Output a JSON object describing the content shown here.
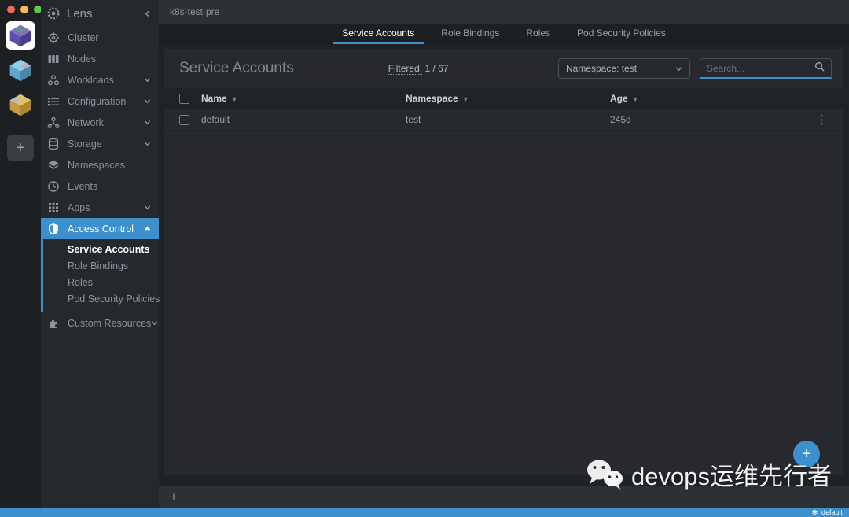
{
  "window": {
    "traffic_lights": [
      "close",
      "minimize",
      "maximize"
    ],
    "cluster_name": "k8s-test-pre"
  },
  "rail": {
    "clusters": [
      "purple-cluster",
      "blue-cluster",
      "yellow-cluster"
    ],
    "add_label": "+"
  },
  "sidebar": {
    "app_title": "Lens",
    "items": [
      {
        "label": "Cluster"
      },
      {
        "label": "Nodes"
      },
      {
        "label": "Workloads"
      },
      {
        "label": "Configuration"
      },
      {
        "label": "Network"
      },
      {
        "label": "Storage"
      },
      {
        "label": "Namespaces"
      },
      {
        "label": "Events"
      },
      {
        "label": "Apps"
      },
      {
        "label": "Access Control"
      },
      {
        "label": "Custom Resources"
      }
    ],
    "access_control_children": [
      {
        "label": "Service Accounts"
      },
      {
        "label": "Role Bindings"
      },
      {
        "label": "Roles"
      },
      {
        "label": "Pod Security Policies"
      }
    ]
  },
  "tabs": [
    {
      "label": "Service Accounts"
    },
    {
      "label": "Role Bindings"
    },
    {
      "label": "Roles"
    },
    {
      "label": "Pod Security Policies"
    }
  ],
  "content": {
    "title": "Service Accounts",
    "filtered_label": "Filtered:",
    "filtered_value": "1 / 67",
    "namespace_select_value": "Namespace: test",
    "search_placeholder": "Search...",
    "table": {
      "columns": [
        {
          "label": "Name"
        },
        {
          "label": "Namespace"
        },
        {
          "label": "Age"
        }
      ],
      "rows": [
        {
          "name": "default",
          "namespace": "test",
          "age": "245d"
        }
      ]
    }
  },
  "dock": {
    "add_label": "+"
  },
  "fab_label": "+",
  "statusbar": {
    "namespace": "default"
  },
  "watermark": {
    "text": "devops运维先行者"
  },
  "colors": {
    "accent_blue": "#3d90ce",
    "panel": "#27292e",
    "sidebar": "#25282d",
    "rail": "#1d2023",
    "traffic_red": "#ed6a5e",
    "traffic_yellow": "#f5bf4f",
    "traffic_green": "#61c554"
  }
}
